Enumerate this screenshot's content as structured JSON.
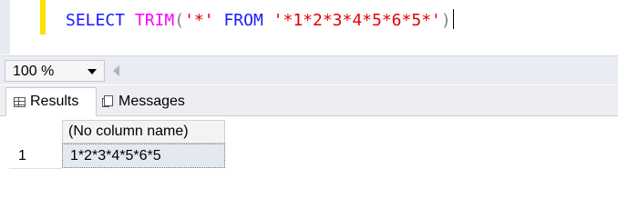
{
  "editor": {
    "code_tokens": {
      "select": "SELECT",
      "trim": "TRIM",
      "open_paren": "(",
      "arg1": "'*'",
      "from": "FROM",
      "arg2": "'*1*2*3*4*5*6*5*'",
      "close_paren": ")"
    }
  },
  "zoom": {
    "value": "100 %"
  },
  "tabs": [
    {
      "label": "Results",
      "icon": "grid-icon"
    },
    {
      "label": "Messages",
      "icon": "messages-icon"
    }
  ],
  "results": {
    "columns": [
      "(No column name)"
    ],
    "rows": [
      {
        "row_number": "1",
        "cells": [
          "1*2*3*4*5*6*5"
        ]
      }
    ]
  },
  "colors": {
    "keyword": "#1a1aff",
    "function": "#ff00ff",
    "string": "#e00000",
    "punctuation": "#808080",
    "change_bar": "#ffe000",
    "selected_cell": "#e4e9ef"
  }
}
